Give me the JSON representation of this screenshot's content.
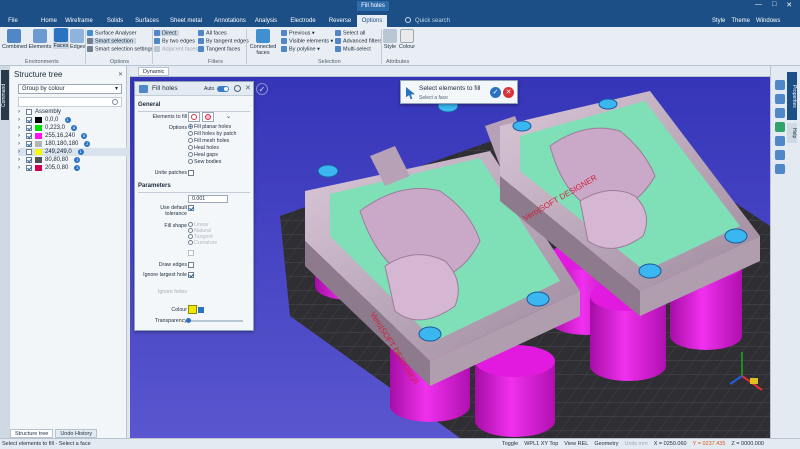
{
  "titlebar": {
    "context_tab": "Fill holes",
    "search_placeholder": "Quick search",
    "style": "Style",
    "theme": "Theme",
    "windows": "Windows"
  },
  "menu_tabs": [
    "File",
    "Home",
    "Wireframe",
    "Solids",
    "Surfaces",
    "Sheet metal",
    "Annotations",
    "Analysis",
    "Electrode",
    "Reverse",
    "Options"
  ],
  "active_tab": "Options",
  "ribbon": {
    "environments": {
      "label": "Environments",
      "combined": "Combined",
      "elements": "Elements",
      "faces": "Faces",
      "edges": "Edges"
    },
    "options": {
      "label": "Options",
      "surface_analyser": "Surface Analyser",
      "smart_selection": "Smart selection",
      "smart_selection_settings": "Smart selection settings"
    },
    "filters": {
      "label": "Filters",
      "direct": "Direct",
      "by_two_edges": "By two edges",
      "adjacent_faces": "Adjacent faces",
      "all_faces": "All faces",
      "by_tangent_edges": "By tangent edges",
      "tangent_faces": "Tangent faces"
    },
    "selection": {
      "label": "Selection",
      "connected_faces": "Connected faces",
      "previous": "Previous",
      "visible_elements": "Visible elements",
      "by_polyline": "By polyline",
      "select_all": "Select all",
      "advanced_filters": "Advanced filters",
      "multi_select": "Multi-select"
    },
    "attributes": {
      "label": "Attributes",
      "style": "Style",
      "colour": "Colour"
    }
  },
  "structure_tree": {
    "title": "Structure tree",
    "group_by": "Group by colour",
    "assembly": "Assembly",
    "rows": [
      {
        "label": "0,0,0",
        "color": "#000000",
        "count": "1",
        "checked": true
      },
      {
        "label": "0,223,0",
        "color": "#00df00",
        "count": "8",
        "checked": true
      },
      {
        "label": "255,16,240",
        "color": "#ff10f0",
        "count": "8",
        "checked": true
      },
      {
        "label": "180,180,180",
        "color": "#b4b4b4",
        "count": "2",
        "checked": true
      },
      {
        "label": "249,249,0",
        "color": "#f9f900",
        "count": "1",
        "checked": false
      },
      {
        "label": "80,80,80",
        "color": "#505050",
        "count": "1",
        "checked": true
      },
      {
        "label": "205,0,80",
        "color": "#cd0050",
        "count": "3",
        "checked": true
      }
    ],
    "bottom_tabs": [
      "Structure tree",
      "Undo History"
    ],
    "command_tab": "Command"
  },
  "viewport": {
    "tab": "Dynamic",
    "brand_text": "Vero|SOFT DESIGNER"
  },
  "dialog": {
    "title": "Fill holes",
    "auto_label": "Auto",
    "general": "General",
    "elements_to_fill": "Elements to fill",
    "options_label": "Options",
    "options": [
      "Fill planar holes",
      "Fill holes by patch",
      "Fill mesh holes",
      "Heal holes",
      "Heal gaps",
      "Sew bodies"
    ],
    "selected_option": "Fill planar holes",
    "unite_patches": "Unite patches",
    "parameters": "Parameters",
    "tolerance_value": "0.001",
    "use_default_tolerance": "Use default tolerance",
    "fill_shape": "Fill shape",
    "fill_shape_options": [
      "Linear",
      "Natural",
      "Tangent",
      "Curvature"
    ],
    "draw_edges": "Draw edges",
    "ignore_largest_hole": "Ignore largest hole",
    "ignore_holes": "Ignore holes",
    "colour": "Colour",
    "colour_value": "#f5e600",
    "transparency": "Transparency"
  },
  "prompt": {
    "title": "Select elements to fill",
    "subtitle": "Select a face"
  },
  "right_panel": {
    "properties": "Properties",
    "help": "Help"
  },
  "statusbar": {
    "message": "Select elements to fill - Select a face",
    "toggle": "Toggle",
    "view_label": "WPL1 XY Top",
    "view_rel": "View REL",
    "geometry": "Geometry",
    "units": "Units mm",
    "x": "X = 0250.060",
    "y": "Y = 0237.435",
    "z": "Z = 0000.000"
  },
  "colors": {
    "accent": "#1b4f86",
    "viewport_bg": "#3a3ac0",
    "mint_face": "#7fe0b8",
    "magenta_cylinder": "#e21ae0",
    "block_grey": "#c7b2c4",
    "brand_red": "#d0203a",
    "hole_blue": "#3ab6f0"
  }
}
